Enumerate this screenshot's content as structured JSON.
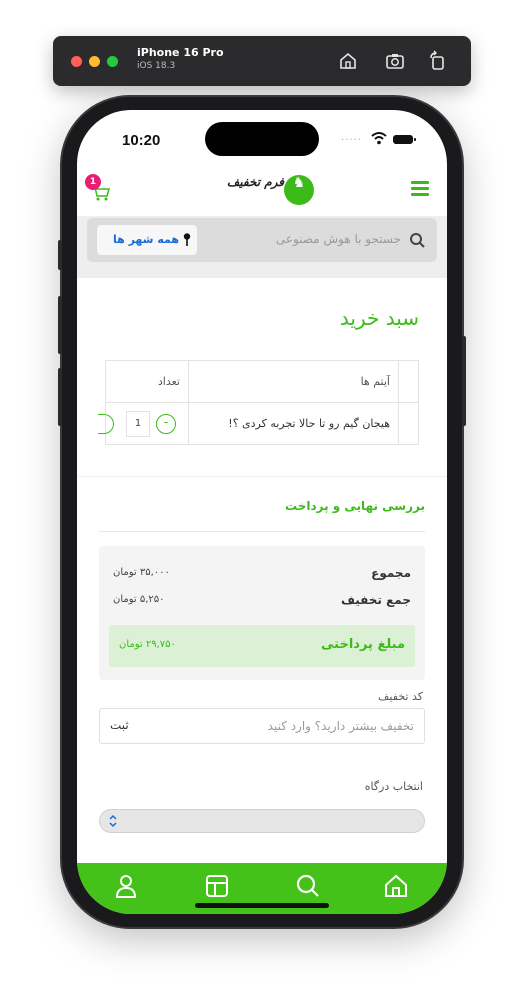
{
  "simulator": {
    "device_name": "iPhone 16 Pro",
    "os_version": "iOS 18.3",
    "icons": [
      "home-icon",
      "screenshot-icon",
      "rotate-icon"
    ]
  },
  "status_bar": {
    "time": "10:20",
    "signal": "....."
  },
  "header": {
    "logo_text": "فرم تخفیف",
    "cart_count": "1",
    "accent_color": "#3cba18"
  },
  "search": {
    "placeholder": "جستجو با هوش مصنوعی",
    "city_label": "همه شهر ها"
  },
  "cart": {
    "title": "سبد خرید",
    "columns": {
      "item": "آیتم ها",
      "qty": "تعداد"
    },
    "rows": [
      {
        "item": "هیجان گیم رو تا حالا تجربه کردی ؟!",
        "qty": "1",
        "minus": "-"
      }
    ]
  },
  "checkout": {
    "title": "بررسی نهایی و پرداخت",
    "total_label": "مجموع",
    "total_value": "۳۵,۰۰۰ تومان",
    "discount_label": "جمع تخفیف",
    "discount_value": "۵,۲۵۰ تومان",
    "payable_label": "مبلغ پرداختی",
    "payable_value": "۲۹,۷۵۰ تومان"
  },
  "discount_code": {
    "label": "کد تخفیف",
    "placeholder": "تخفیف بیشتر دارید؟ وارد کنید",
    "submit": "ثبت"
  },
  "gateway": {
    "label": "انتخاب درگاه",
    "selected": ""
  },
  "bottom_nav": {
    "color": "#44c21a",
    "items": [
      "profile-icon",
      "category-icon",
      "search-icon",
      "home-icon"
    ]
  }
}
